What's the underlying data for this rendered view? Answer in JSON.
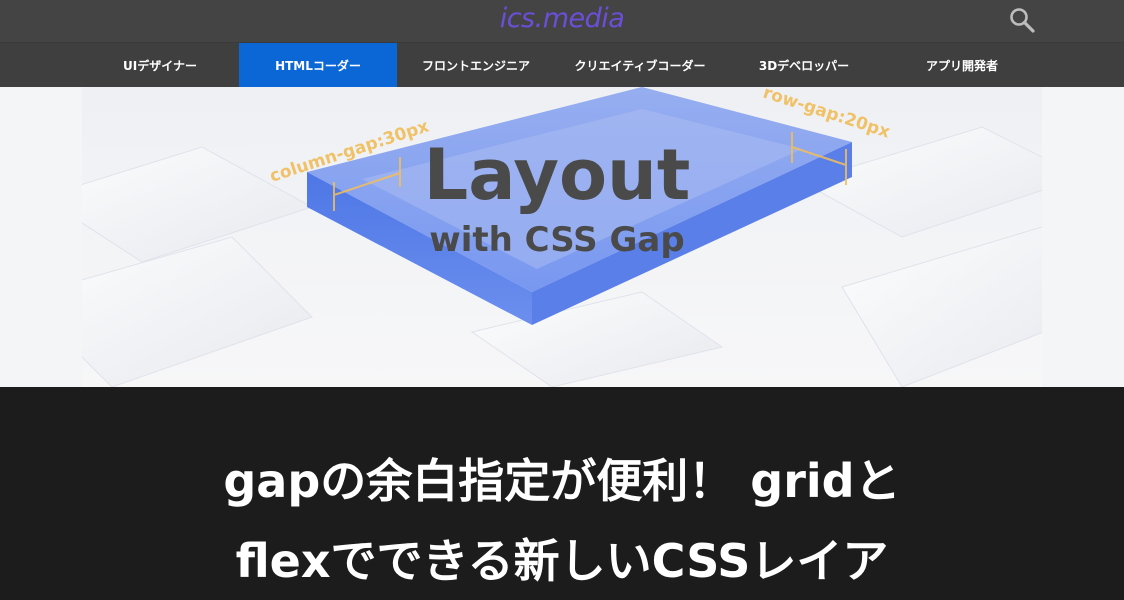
{
  "site": {
    "logo": "ics.media",
    "logo_color": "#6b4fd8",
    "search_icon": "search-icon"
  },
  "nav": {
    "active_color": "#0b66d6",
    "items": [
      {
        "label": "UIデザイナー",
        "active": false
      },
      {
        "label": "HTMLコーダー",
        "active": true
      },
      {
        "label": "フロントエンジニア",
        "active": false
      },
      {
        "label": "クリエイティブコーダー",
        "active": false
      },
      {
        "label": "3Dデベロッパー",
        "active": false
      },
      {
        "label": "アプリ開発者",
        "active": false
      }
    ]
  },
  "hero": {
    "title": "Layout",
    "subtitle": "with CSS Gap",
    "column_gap_label": "column-gap:30px",
    "row_gap_label": "row-gap:20px"
  },
  "article": {
    "title_line1": "gapの余白指定が便利！ gridと",
    "title_line2": "flexでできる新しいCSSレイア"
  }
}
